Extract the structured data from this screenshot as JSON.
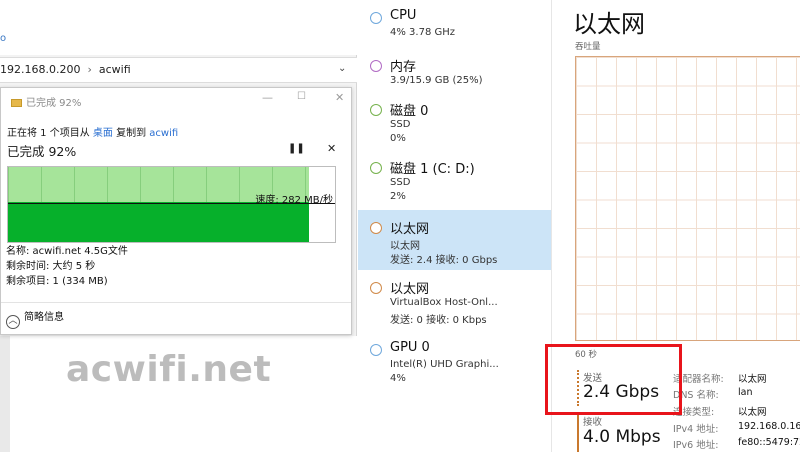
{
  "explorer": {
    "address_path": [
      "192.168.0.200",
      "acwifi"
    ],
    "dropdown_icon": "chevron-down-icon"
  },
  "copy_dialog": {
    "title": "已完成 92%",
    "progress_line": {
      "prefix": "正在将 1 个项目从 ",
      "source": "桌面",
      "middle": " 复制到 ",
      "destination": "acwifi"
    },
    "progress_text": "已完成 92%",
    "progress": 0.92,
    "speed_label": "速度: 282 MB/秒",
    "name_line": "名称: acwifi.net 4.5G文件",
    "time_remaining": "剩余时间: 大约 5 秒",
    "items_remaining": "剩余项目: 1 (334 MB)",
    "less_info": "简略信息",
    "colors": {
      "graph_light": "#a6e49a",
      "graph_dark": "#06b02b"
    }
  },
  "watermark": "acwifi.net",
  "task_manager": {
    "resources": [
      {
        "name": "CPU",
        "sub1": "4% 3.78 GHz",
        "sub2": "",
        "dot_color": "#6fa8dc",
        "selected": false
      },
      {
        "name": "内存",
        "sub1": "3.9/15.9 GB (25%)",
        "sub2": "",
        "dot_color": "#b16bc4",
        "selected": false
      },
      {
        "name": "磁盘 0",
        "sub1": "SSD",
        "sub2": "0%",
        "dot_color": "#76b24d",
        "selected": false
      },
      {
        "name": "磁盘 1 (C: D:)",
        "sub1": "SSD",
        "sub2": "2%",
        "dot_color": "#76b24d",
        "selected": false
      },
      {
        "name": "以太网",
        "sub1": "以太网",
        "sub2": "发送: 2.4 接收: 0 Gbps",
        "dot_color": "#d08a4a",
        "selected": true
      },
      {
        "name": "以太网",
        "sub1": "VirtualBox Host-Onl...",
        "sub2": "发送: 0 接收: 0 Kbps",
        "dot_color": "#d08a4a",
        "selected": false
      },
      {
        "name": "GPU 0",
        "sub1": "Intel(R) UHD Graphi...",
        "sub2": "4%",
        "dot_color": "#6fa8dc",
        "selected": false
      }
    ],
    "detail": {
      "title": "以太网",
      "throughput_label": "吞吐量",
      "axis_label": "60 秒",
      "send_label": "发送",
      "send_value": "2.4 Gbps",
      "recv_label": "接收",
      "recv_value": "4.0 Mbps",
      "properties": [
        {
          "key": "适配器名称:",
          "value": "以太网"
        },
        {
          "key": "DNS 名称:",
          "value": "lan"
        },
        {
          "key": "连接类型:",
          "value": "以太网"
        },
        {
          "key": "IPv4 地址:",
          "value": "192.168.0.16"
        },
        {
          "key": "IPv6 地址:",
          "value": "fe80::5479:72"
        }
      ],
      "graph_color": "#d8a57c"
    },
    "highlight_color": "#e8141b"
  }
}
